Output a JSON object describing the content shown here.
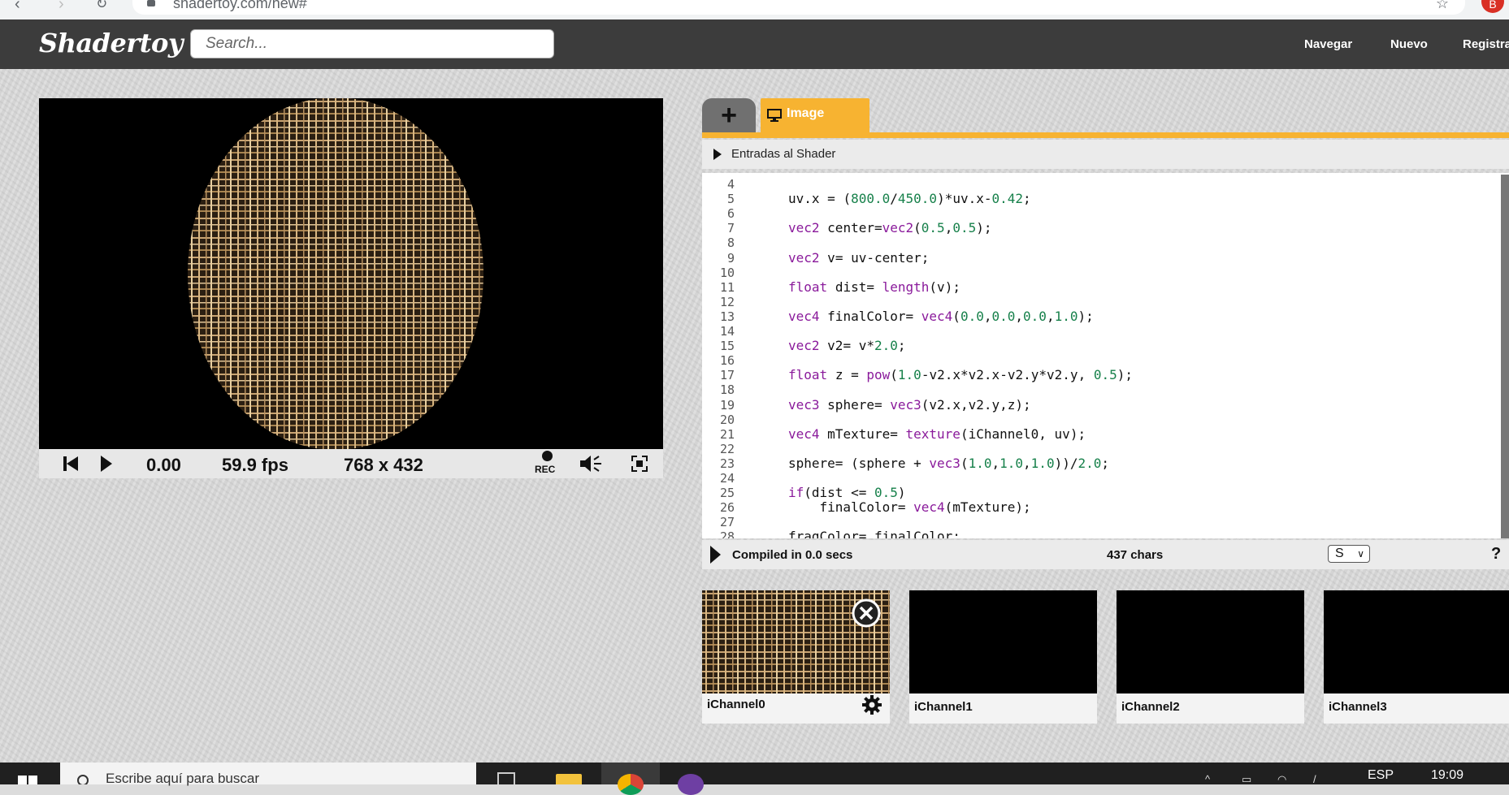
{
  "browser": {
    "url": "shadertoy.com/new#"
  },
  "header": {
    "logo": "Shadertoy",
    "search_placeholder": "Search...",
    "nav": [
      "Navegar",
      "Nuevo",
      "Registra"
    ]
  },
  "player": {
    "time": "0.00",
    "fps": "59.9 fps",
    "resolution": "768 x 432",
    "rec_label": "REC"
  },
  "editor": {
    "tab_image_label": "Image",
    "inputs_label": "Entradas al Shader",
    "lines": [
      {
        "n": "4",
        "code": ""
      },
      {
        "n": "5",
        "code": "uv.x = (800.0/450.0)*uv.x-0.42;"
      },
      {
        "n": "6",
        "code": ""
      },
      {
        "n": "7",
        "code": "vec2 center=vec2(0.5,0.5);"
      },
      {
        "n": "8",
        "code": ""
      },
      {
        "n": "9",
        "code": "vec2 v= uv-center;"
      },
      {
        "n": "10",
        "code": ""
      },
      {
        "n": "11",
        "code": "float dist= length(v);"
      },
      {
        "n": "12",
        "code": ""
      },
      {
        "n": "13",
        "code": "vec4 finalColor= vec4(0.0,0.0,0.0,1.0);"
      },
      {
        "n": "14",
        "code": ""
      },
      {
        "n": "15",
        "code": "vec2 v2= v*2.0;"
      },
      {
        "n": "16",
        "code": ""
      },
      {
        "n": "17",
        "code": "float z = pow(1.0-v2.x*v2.x-v2.y*v2.y, 0.5);"
      },
      {
        "n": "18",
        "code": ""
      },
      {
        "n": "19",
        "code": "vec3 sphere= vec3(v2.x,v2.y,z);"
      },
      {
        "n": "20",
        "code": ""
      },
      {
        "n": "21",
        "code": "vec4 mTexture= texture(iChannel0, uv);"
      },
      {
        "n": "22",
        "code": ""
      },
      {
        "n": "23",
        "code": "sphere= (sphere + vec3(1.0,1.0,1.0))/2.0;"
      },
      {
        "n": "24",
        "code": ""
      },
      {
        "n": "25",
        "code": "if(dist <= 0.5)"
      },
      {
        "n": "26",
        "code": "    finalColor= vec4(mTexture);"
      },
      {
        "n": "27",
        "code": ""
      },
      {
        "n": "28",
        "code": "fragColor= finalColor;"
      }
    ],
    "compiled": "Compiled in 0.0 secs",
    "chars": "437 chars",
    "font_select": "S",
    "help": "?"
  },
  "channels": [
    "iChannel0",
    "iChannel1",
    "iChannel2",
    "iChannel3"
  ],
  "taskbar": {
    "search_text": "Escribe aquí para buscar",
    "lang": "ESP",
    "time": "19:09"
  },
  "colors": {
    "accent": "#f7b331",
    "header_bg": "#3c3c3c",
    "keyword": "#8a1a9b",
    "number": "#16804a"
  }
}
